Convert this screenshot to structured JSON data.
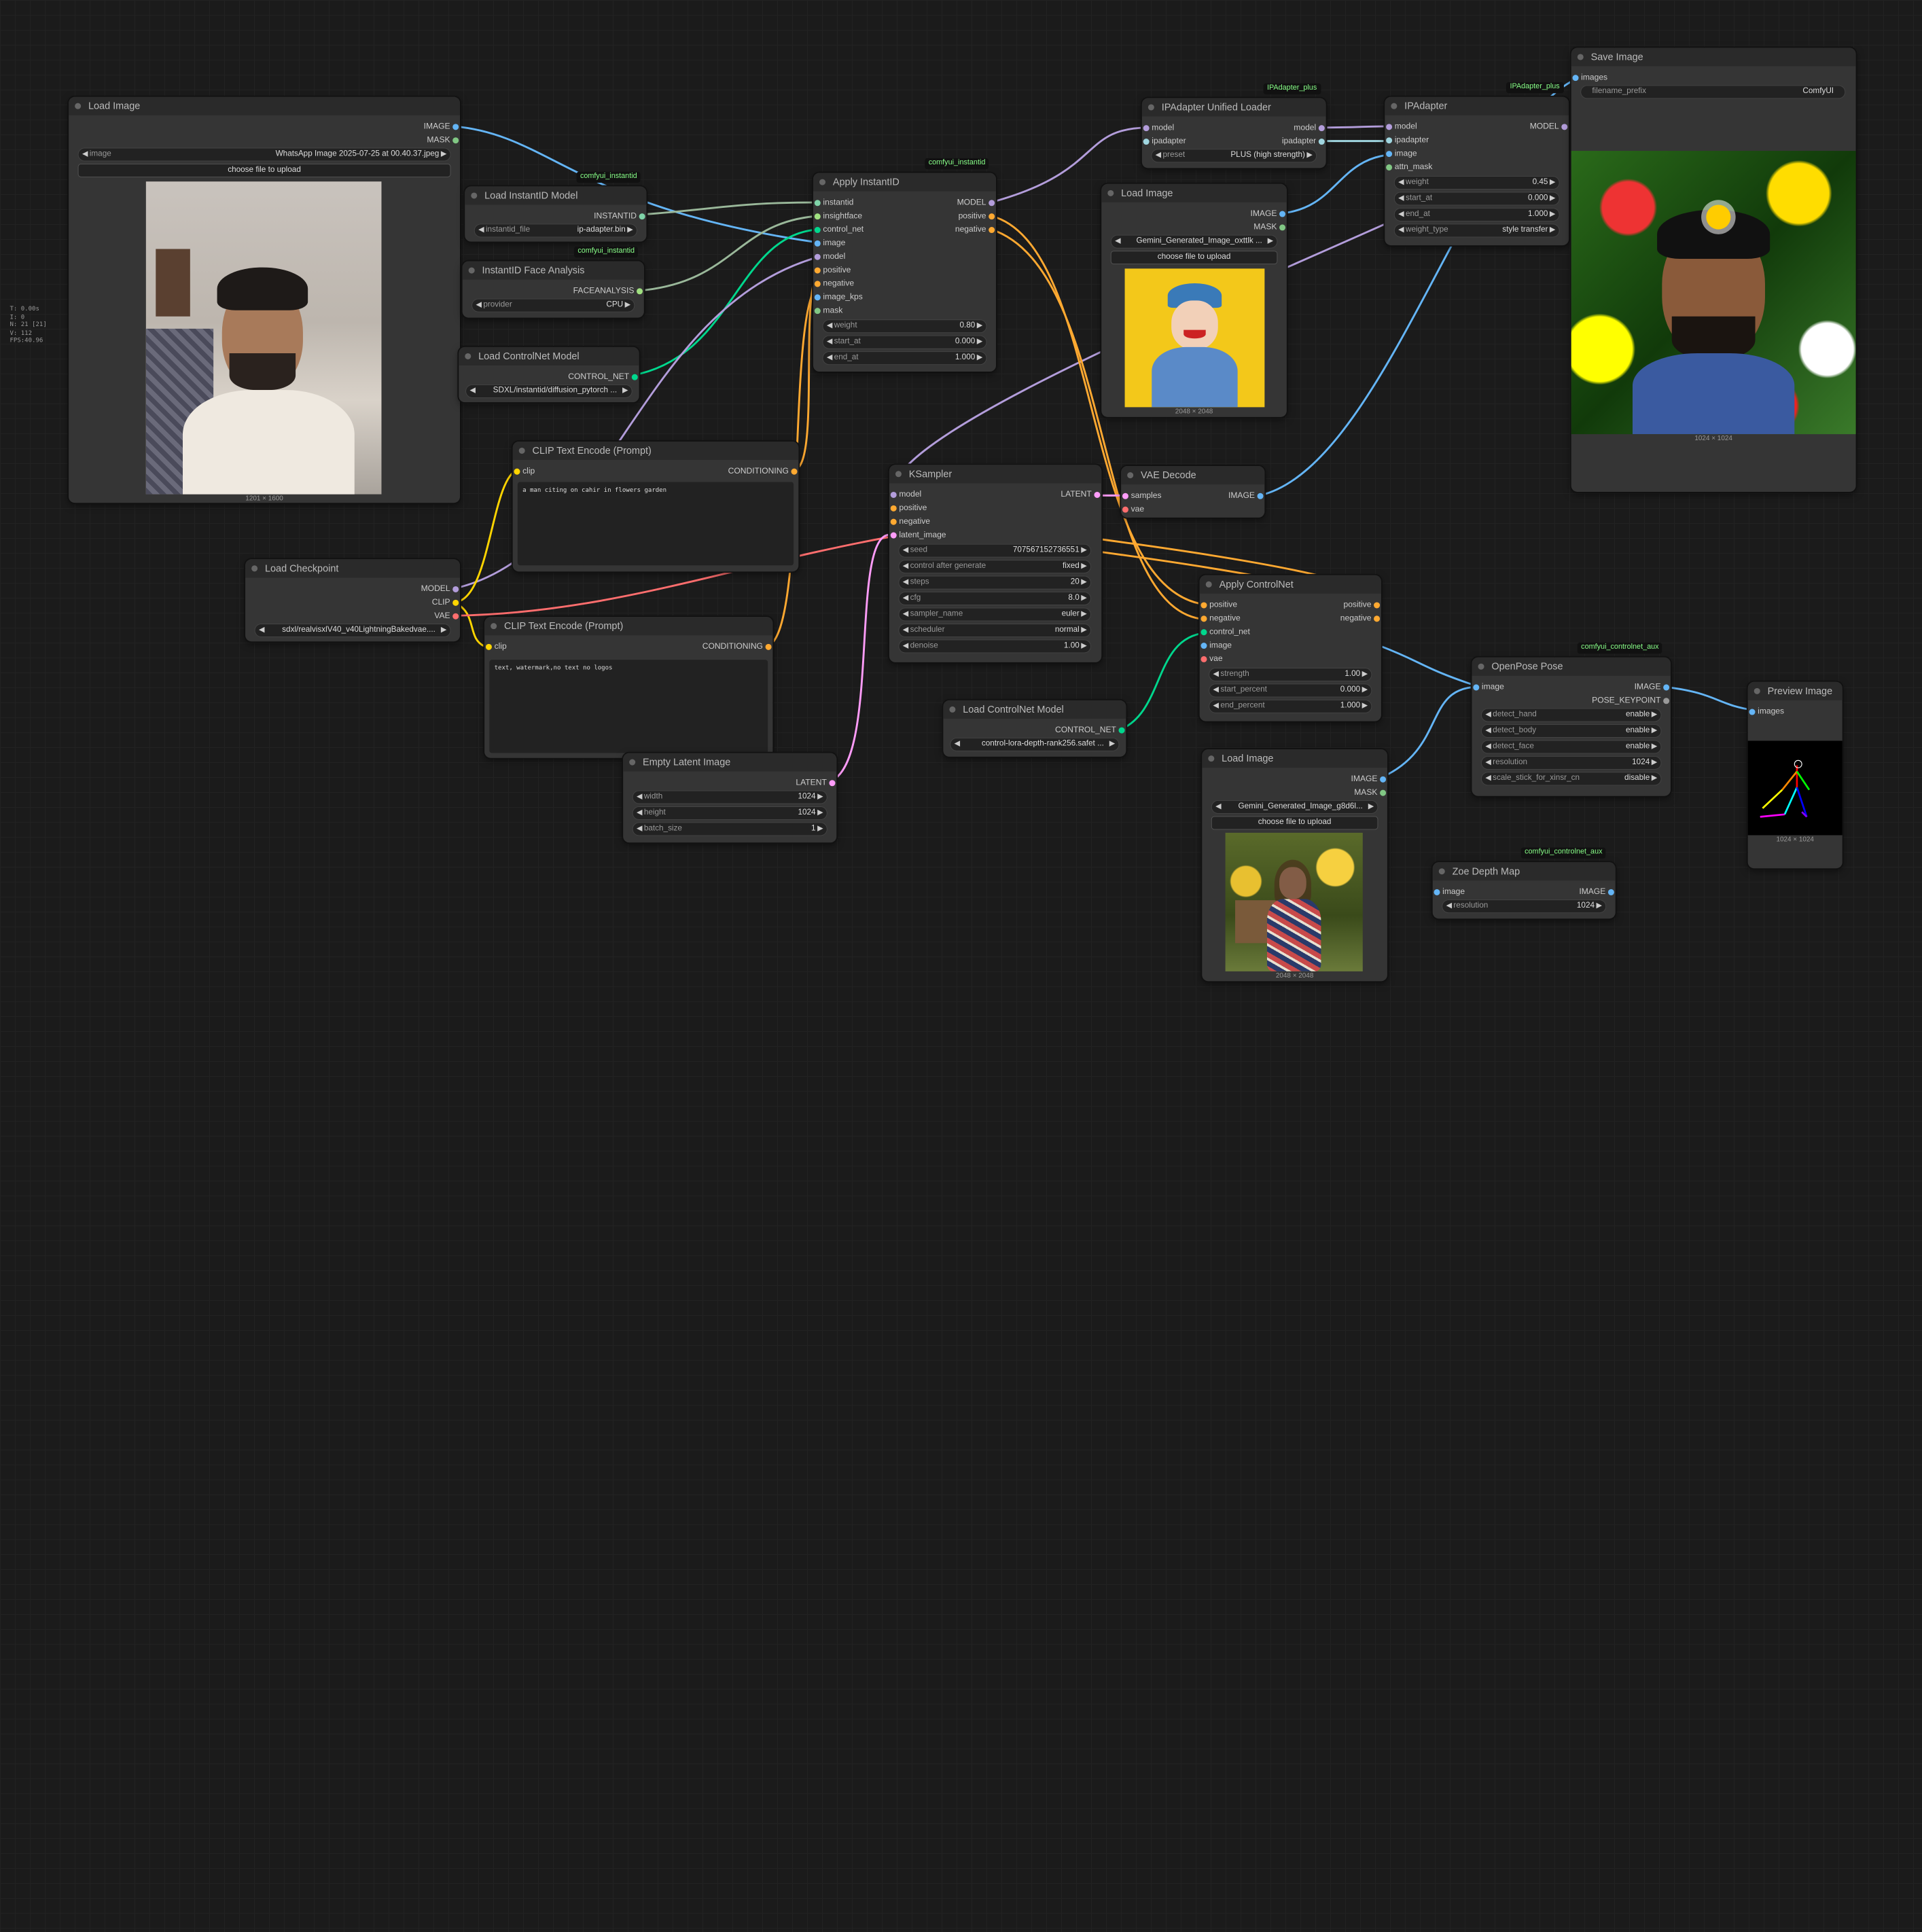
{
  "colors": {
    "model": "#b39ddb",
    "clip": "#ffd500",
    "vae": "#ff6e6e",
    "conditioning": "#ffa931",
    "latent": "#ff9cf9",
    "image": "#64b5f6",
    "mask": "#81c784",
    "control_net": "#00d78d",
    "instantid": "#7fd3a8",
    "faceanalysis": "#a0e080",
    "ipadapter": "#a0d6e0"
  },
  "stats": {
    "line1": "T: 0.00s",
    "line2": "I: 0",
    "line3": "N: 21 [21]",
    "line4": "V: 112",
    "line5": "FPS:40.96"
  },
  "nodes": {
    "load_image_1": {
      "title": "Load Image",
      "out_image": "IMAGE",
      "out_mask": "MASK",
      "image_label": "image",
      "image_value": "WhatsApp Image 2025-07-25 at 00.40.37.jpeg",
      "upload": "choose file to upload",
      "caption": "1201 × 1600"
    },
    "load_instantid": {
      "title": "Load InstantID Model",
      "badge": "comfyui_instantid",
      "out": "INSTANTID",
      "w_label": "instantid_file",
      "w_value": "ip-adapter.bin"
    },
    "face_analysis": {
      "title": "InstantID Face Analysis",
      "badge": "comfyui_instantid",
      "out": "FACEANALYSIS",
      "w_label": "provider",
      "w_value": "CPU"
    },
    "load_controlnet_1": {
      "title": "Load ControlNet Model",
      "out": "CONTROL_NET",
      "w_value": "SDXL/instantid/diffusion_pytorch ..."
    },
    "apply_instantid": {
      "title": "Apply InstantID",
      "badge": "comfyui_instantid",
      "inputs": [
        "instantid",
        "insightface",
        "control_net",
        "image",
        "model",
        "positive",
        "negative",
        "image_kps",
        "mask"
      ],
      "outputs": [
        "MODEL",
        "positive",
        "negative"
      ],
      "widgets": [
        {
          "label": "weight",
          "value": "0.80"
        },
        {
          "label": "start_at",
          "value": "0.000"
        },
        {
          "label": "end_at",
          "value": "1.000"
        }
      ]
    },
    "ipa_loader": {
      "title": "IPAdapter Unified Loader",
      "badge": "IPAdapter_plus",
      "in_model": "model",
      "in_ipadapter": "ipadapter",
      "out_model": "model",
      "out_ipadapter": "ipadapter",
      "w_label": "preset",
      "w_value": "PLUS (high strength)"
    },
    "ipadapter": {
      "title": "IPAdapter",
      "badge": "IPAdapter_plus",
      "inputs": [
        "model",
        "ipadapter",
        "image",
        "attn_mask"
      ],
      "out": "MODEL",
      "widgets": [
        {
          "label": "weight",
          "value": "0.45"
        },
        {
          "label": "start_at",
          "value": "0.000"
        },
        {
          "label": "end_at",
          "value": "1.000"
        },
        {
          "label": "weight_type",
          "value": "style transfer"
        }
      ]
    },
    "save_image": {
      "title": "Save Image",
      "in": "images",
      "w_label": "filename_prefix",
      "w_value": "ComfyUI",
      "caption": "1024 × 1024"
    },
    "load_image_2": {
      "title": "Load Image",
      "out_image": "IMAGE",
      "out_mask": "MASK",
      "image_value": "Gemini_Generated_Image_oxttlk ...",
      "upload": "choose file to upload",
      "caption": "2048 × 2048"
    },
    "clip_pos": {
      "title": "CLIP Text Encode (Prompt)",
      "in": "clip",
      "out": "CONDITIONING",
      "text": "a man citing on cahir in flowers garden"
    },
    "clip_neg": {
      "title": "CLIP Text Encode (Prompt)",
      "in": "clip",
      "out": "CONDITIONING",
      "text": "text, watermark,no text no logos"
    },
    "ksampler": {
      "title": "KSampler",
      "inputs": [
        "model",
        "positive",
        "negative",
        "latent_image"
      ],
      "out": "LATENT",
      "widgets": [
        {
          "label": "seed",
          "value": "707567152736551"
        },
        {
          "label": "control after generate",
          "value": "fixed"
        },
        {
          "label": "steps",
          "value": "20"
        },
        {
          "label": "cfg",
          "value": "8.0"
        },
        {
          "label": "sampler_name",
          "value": "euler"
        },
        {
          "label": "scheduler",
          "value": "normal"
        },
        {
          "label": "denoise",
          "value": "1.00"
        }
      ]
    },
    "vae_decode": {
      "title": "VAE Decode",
      "in_samples": "samples",
      "in_vae": "vae",
      "out": "IMAGE"
    },
    "load_checkpoint": {
      "title": "Load Checkpoint",
      "out_model": "MODEL",
      "out_clip": "CLIP",
      "out_vae": "VAE",
      "w_value": "sdxl/realvisxlV40_v40LightningBakedvae...."
    },
    "empty_latent": {
      "title": "Empty Latent Image",
      "out": "LATENT",
      "widgets": [
        {
          "label": "width",
          "value": "1024"
        },
        {
          "label": "height",
          "value": "1024"
        },
        {
          "label": "batch_size",
          "value": "1"
        }
      ]
    },
    "apply_controlnet": {
      "title": "Apply ControlNet",
      "inputs": [
        "positive",
        "negative",
        "control_net",
        "image",
        "vae"
      ],
      "out_pos": "positive",
      "out_neg": "negative",
      "widgets": [
        {
          "label": "strength",
          "value": "1.00"
        },
        {
          "label": "start_percent",
          "value": "0.000"
        },
        {
          "label": "end_percent",
          "value": "1.000"
        }
      ]
    },
    "load_controlnet_2": {
      "title": "Load ControlNet Model",
      "out": "CONTROL_NET",
      "w_value": "control-lora-depth-rank256.safet ..."
    },
    "openpose": {
      "title": "OpenPose Pose",
      "badge": "comfyui_controlnet_aux",
      "in": "image",
      "out_image": "IMAGE",
      "out_kp": "POSE_KEYPOINT",
      "widgets": [
        {
          "label": "detect_hand",
          "value": "enable"
        },
        {
          "label": "detect_body",
          "value": "enable"
        },
        {
          "label": "detect_face",
          "value": "enable"
        },
        {
          "label": "resolution",
          "value": "1024"
        },
        {
          "label": "scale_stick_for_xinsr_cn",
          "value": "disable"
        }
      ]
    },
    "preview": {
      "title": "Preview Image",
      "in": "images",
      "caption": "1024 × 1024"
    },
    "load_image_3": {
      "title": "Load Image",
      "out_image": "IMAGE",
      "out_mask": "MASK",
      "image_value": "Gemini_Generated_Image_g8d6l...",
      "upload": "choose file to upload",
      "caption": "2048 × 2048"
    },
    "zoe": {
      "title": "Zoe Depth Map",
      "badge": "comfyui_controlnet_aux",
      "in": "image",
      "out": "IMAGE",
      "w_label": "resolution",
      "w_value": "1024"
    }
  }
}
